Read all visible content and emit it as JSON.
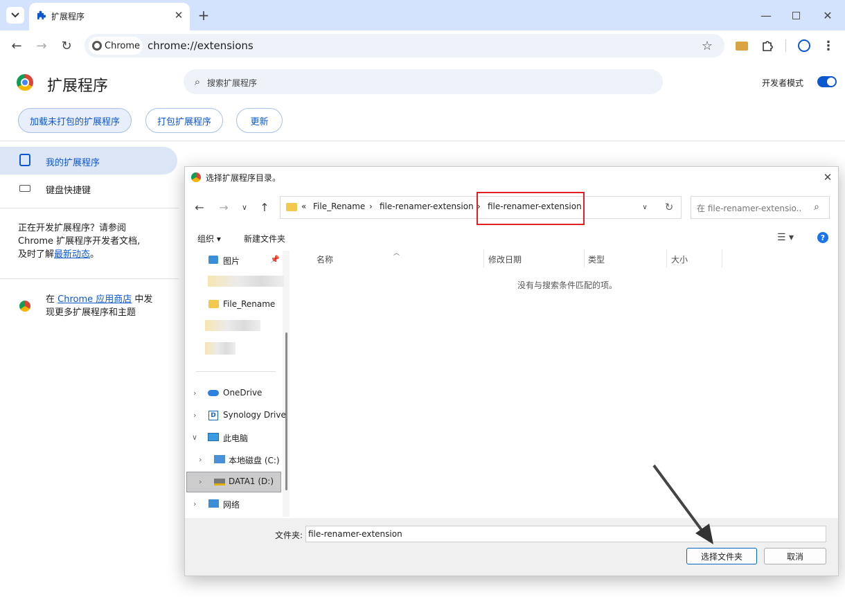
{
  "browser": {
    "tab_title": "扩展程序",
    "new_tab": "+",
    "chip_label": "Chrome",
    "url": "chrome://extensions"
  },
  "page": {
    "title": "扩展程序",
    "search_placeholder": "搜索扩展程序",
    "dev_mode_label": "开发者模式",
    "dev_mode_on": true,
    "buttons": {
      "load_unpacked": "加载未打包的扩展程序",
      "pack": "打包扩展程序",
      "update": "更新"
    },
    "nav": {
      "my_extensions": "我的扩展程序",
      "shortcuts": "键盘快捷键"
    },
    "dev_note": {
      "line1": "正在开发扩展程序？请参阅",
      "line2": "Chrome 扩展程序开发者文档,",
      "line3_pre": "及时了解",
      "line3_link": "最新动态",
      "line3_post": "。"
    },
    "store_note": {
      "pre": "在 ",
      "link": "Chrome 应用商店",
      "post": " 中发",
      "line2": "现更多扩展程序和主题"
    }
  },
  "dialog": {
    "title": "选择扩展程序目录。",
    "breadcrumb": {
      "prefix": "«",
      "items": [
        "File_Rename",
        "file-renamer-extension",
        "file-renamer-extension"
      ]
    },
    "search_placeholder": "在 file-renamer-extensio...",
    "toolbar": {
      "organize": "组织 ▾",
      "new_folder": "新建文件夹"
    },
    "tree": {
      "pictures": "图片",
      "file_rename": "File_Rename",
      "onedrive": "OneDrive",
      "synology": "Synology Drive",
      "this_pc": "此电脑",
      "local_c": "本地磁盘 (C:)",
      "data1": "DATA1 (D:)",
      "network": "网络"
    },
    "columns": [
      "名称",
      "修改日期",
      "类型",
      "大小"
    ],
    "empty_message": "没有与搜索条件匹配的项。",
    "folder_label": "文件夹:",
    "folder_value": "file-renamer-extension",
    "select_button": "选择文件夹",
    "cancel_button": "取消"
  },
  "colors": {
    "accent": "#0b57d0",
    "tabbar": "#d3e3fd",
    "highlight_box": "#e02020"
  }
}
